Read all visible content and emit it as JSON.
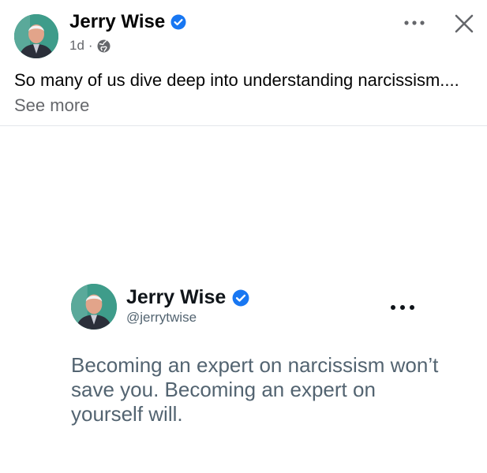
{
  "post": {
    "author": "Jerry Wise",
    "time": "1d",
    "separator": "·",
    "audience_icon": "globe-icon",
    "text": "So many of us dive deep into understanding narcissism....",
    "see_more": "See more"
  },
  "tweet": {
    "name": "Jerry Wise",
    "handle": "@jerrytwise",
    "text": "Becoming an expert on narcissism won’t save you. Becoming an expert on yourself will."
  },
  "colors": {
    "verified": "#1877f2",
    "secondary_text": "#65676b",
    "tweet_text": "#536471"
  }
}
